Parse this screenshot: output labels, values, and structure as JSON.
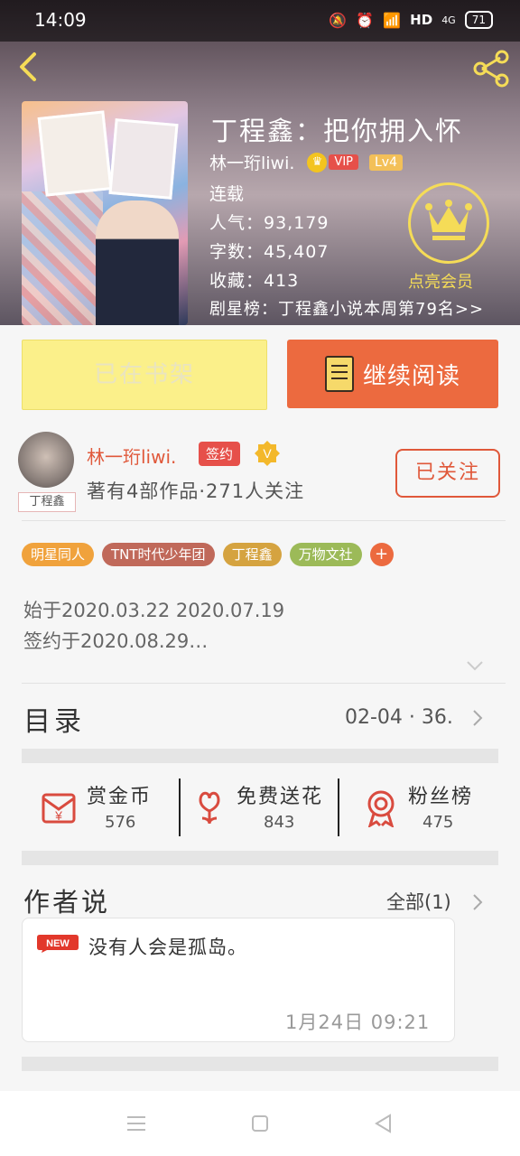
{
  "status_bar": {
    "time": "14:09",
    "network": "HD",
    "signal": "4G",
    "battery": "71"
  },
  "book": {
    "title": "丁程鑫：把你拥入怀",
    "author": "林一珩liwi.",
    "vip_label": "VIP",
    "level": "Lv4",
    "status": "连载",
    "popularity": "人气：93,179",
    "word_count": "字数：45,407",
    "favorites": "收藏：413",
    "rank": "剧星榜：丁程鑫小说本周第79名>>",
    "vip_cta": "点亮会员"
  },
  "buttons": {
    "on_shelf": "已在书架",
    "continue_reading": "继续阅读"
  },
  "author_info": {
    "name": "林一珩liwi.",
    "signed_badge": "签约",
    "v_badge": "V",
    "works_followers": "著有4部作品·271人关注",
    "follow_button": "已关注",
    "avatar_tag": "丁程鑫"
  },
  "tags": [
    {
      "label": "明星同人",
      "color": "#f0a23c"
    },
    {
      "label": "TNT时代少年团",
      "color": "#c0695a"
    },
    {
      "label": "丁程鑫",
      "color": "#d5a340"
    },
    {
      "label": "万物文社",
      "color": "#9cba58"
    }
  ],
  "tag_add": "+",
  "dates": {
    "start": "始于2020.03.22 2020.07.19",
    "signed": "签约于2020.08.29…"
  },
  "toc": {
    "label": "目录",
    "latest": "02-04 · 36."
  },
  "gifts": [
    {
      "label": "赏金币",
      "count": "576",
      "icon": "coin-envelope-icon"
    },
    {
      "label": "免费送花",
      "count": "843",
      "icon": "flower-icon"
    },
    {
      "label": "粉丝榜",
      "count": "475",
      "icon": "medal-icon"
    }
  ],
  "author_says": {
    "title": "作者说",
    "all_link": "全部(1)",
    "new_badge": "NEW",
    "message": "没有人会是孤岛。",
    "time": "1月24日  09:21"
  },
  "colors": {
    "accent": "#ec6a3f",
    "shelf_button": "#fbf08a",
    "vip_gold": "#f5dc57"
  }
}
